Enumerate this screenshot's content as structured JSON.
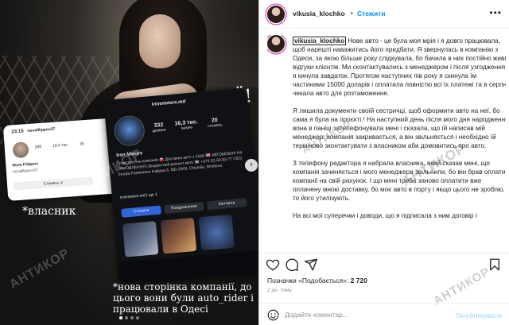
{
  "post": {
    "username": "vikusia_klochko",
    "follow_label": "Стежити",
    "separator": "•",
    "more_icon": "more-horizontal-icon",
    "caption_user": "vikusia_klochko",
    "caption_paragraphs": [
      "Нове авто - це була моя мрія і я довго працювала, щоб нарешті наважитись його придбати. Я звернулась в компанію з Одеси, за якою більше року слідкувала, бо бачила в них постійно живі відгуки клієнтів. Ми сконтактувались з менеджером і після узгодження я кинула завдаток. Протягом наступних пів року я скинула їм частинами 15000 доларів і оплатила повністю всі їх платежі та в серпні чекала авто для розтаможення.",
      "Я лишила документи своїй сестричці, щоб оформити авто на неї, бо сама я була на проєкті.! На наступний день після мого дня народження вона в паніці зателефонувала мені і сказала, що їй написав мій менеджер: компанія закривається, а він звільняється і необхідно їй терміново зконтактувати з власником аби домовитись про авто.",
      "З телефону редактора я набрала власника, який сказав мені, що компанія зачиняється і мого менеджера звільнили, бо він брав оплати компанії на свій рахунок. І що мені треба заново оплатити вже оплачену мною доставку, бо моє авто в порту і якщо цього не зроблю, то його утилізують.",
      "На всі мої суперечки і доводи, що я підписала з ним договір і"
    ],
    "likes_prefix": "Позначки «Подобається»: ",
    "likes_count": "2 720",
    "date": "2 дн. тому",
    "comment_placeholder": "Додайте коментар...",
    "publish_label": "Опублікувати"
  },
  "image": {
    "headline": "ШАХРАЇ!",
    "owner_caption": "*власник",
    "company_caption": "*нова сторінка компанії, до цього вони були auto_rider і працювали в Одесі",
    "watermark": "АНТИКОР",
    "slide_count": 4,
    "active_slide": 1,
    "owner_phone": {
      "time": "23:15",
      "username": "novafilippov37",
      "stats": [
        "340",
        "10,4 тис.",
        "35"
      ],
      "name": "Nova Filippov",
      "sub": "novafilippov37",
      "button": "Стежить ∨"
    },
    "company_phone": {
      "username": "ironmotors.md",
      "posts": "332",
      "posts_label": "дописи",
      "followers": "16,3 тис.",
      "followers_label": "читачі",
      "following": "20",
      "following_label": "стежить",
      "name": "Iron Motors",
      "bio": "Транспортна компанія 🚘 Доставка авто з США 🇺🇸 АВТОМОБІЛІ НА ЗАМОВЛЕННЯ | Бюджетний ремонт авто ☎ +373 (0) 60-92-77 СЕО Strada Pantelimon Halippa 6, MD-2009, Chișinău, Moldova",
      "link": "ironmotors.md | ще 1",
      "buttons": [
        "Стежити",
        "Повідомлення",
        "Контакти"
      ]
    }
  }
}
